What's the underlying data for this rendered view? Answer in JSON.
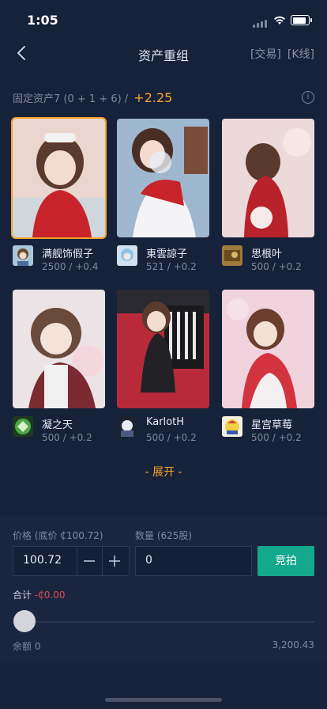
{
  "status": {
    "time": "1:05"
  },
  "nav": {
    "title": "资产重组",
    "trade_link": "[交易]",
    "kline_link": "[K线]"
  },
  "assets": {
    "label": "固定资产7 (0 + 1 + 6) /",
    "delta": "+2.25",
    "info_icon": "i"
  },
  "cards": [
    {
      "name": "满舰饰假子",
      "stats": "2500 / +0.4",
      "selected": true
    },
    {
      "name": "東雲諒子",
      "stats": "521 / +0.2",
      "selected": false
    },
    {
      "name": "思根叶",
      "stats": "500 / +0.2",
      "selected": false
    },
    {
      "name": "凝之天",
      "stats": "500 / +0.2",
      "selected": false
    },
    {
      "name": "KarlotH",
      "stats": "500 / +0.2",
      "selected": false
    },
    {
      "name": "星宫草莓",
      "stats": "500 / +0.2",
      "selected": false
    }
  ],
  "expand_label": "- 展开 -",
  "trade": {
    "price_label": "价格 (底价 ₵100.72)",
    "price_value": "100.72",
    "qty_label": "数量 (625股)",
    "qty_value": "0",
    "bid_button": "竞拍",
    "total_label": "合计",
    "total_value": "-₵0.00",
    "balance_label": "余额 0",
    "max_value": "3,200.43",
    "slider_fraction": 0
  },
  "colors": {
    "accent": "#f7a42a",
    "primary": "#14a88c",
    "negative": "#e0484e",
    "background": "#16213a"
  }
}
